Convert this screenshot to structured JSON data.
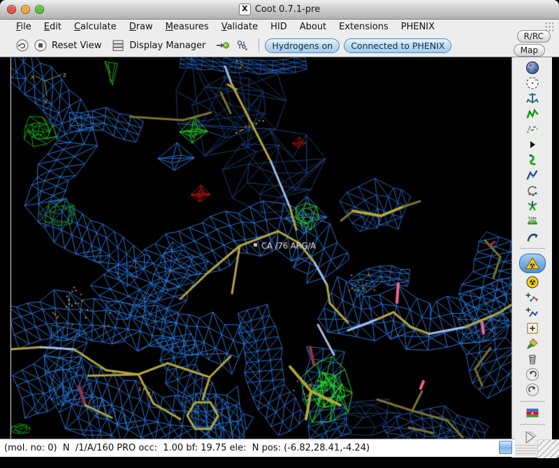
{
  "window": {
    "title": "Coot 0.7.1-pre",
    "logo_glyph": "X",
    "traffic_colors": {
      "close": "#e8554a",
      "minimize": "#f5a63b",
      "zoom": "#58c43d"
    }
  },
  "menu": {
    "items": [
      {
        "label": "File",
        "u": 0
      },
      {
        "label": "Edit",
        "u": 0
      },
      {
        "label": "Calculate",
        "u": 0
      },
      {
        "label": "Draw",
        "u": 0
      },
      {
        "label": "Measures",
        "u": 0
      },
      {
        "label": "Validate",
        "u": 0
      },
      {
        "label": "HID",
        "u": -1
      },
      {
        "label": "About",
        "u": -1
      },
      {
        "label": "Extensions",
        "u": -1
      },
      {
        "label": "PHENIX",
        "u": -1
      }
    ]
  },
  "toolbar": {
    "reset_view": "Reset View",
    "display_manager": "Display Manager",
    "hydrogens_toggle": "Hydrogens on",
    "phenix_toggle": "Connected to PHENIX",
    "toggle_accent": "#bcd9f1"
  },
  "side_buttons": {
    "rrc": "R/RC",
    "map": "Map"
  },
  "right_toolbar": {
    "icons": [
      {
        "name": "sphere-icon"
      },
      {
        "name": "dashed-circle-icon"
      },
      {
        "name": "anchor-icon"
      },
      {
        "name": "green-zigzag-icon"
      },
      {
        "name": "dotted-zigzag-icon"
      },
      {
        "name": "black-triangle-icon"
      },
      {
        "name": "green-rotamer-icon"
      },
      {
        "name": "blue-zigzag-icon"
      },
      {
        "name": "circular-arrow-icon"
      },
      {
        "name": "pinwheel-icon"
      },
      {
        "name": "side-hemisphere-icon"
      },
      {
        "name": "blue-swoosh-icon"
      },
      {
        "name": "separator"
      },
      {
        "name": "radiation-triangle-button",
        "active": true
      },
      {
        "name": "radiation-icon"
      },
      {
        "name": "plus-molecule-icon"
      },
      {
        "name": "plus-blue-molecule-icon"
      },
      {
        "name": "plus-box-icon"
      },
      {
        "name": "paintbrush-icon"
      },
      {
        "name": "trash-icon"
      },
      {
        "name": "undo-icon"
      },
      {
        "name": "redo-icon"
      },
      {
        "name": "separator"
      },
      {
        "name": "flag-icon"
      },
      {
        "name": "separator"
      },
      {
        "name": "expand-triangle-icon"
      }
    ]
  },
  "scene": {
    "atom_label": "CA /76 ARG/A",
    "axes": {
      "x": "x",
      "y": "y",
      "z": "z"
    },
    "colors": {
      "background": "#000000",
      "density_2fofc": "#2b7ce0",
      "density_2fofc_dark": "#1b4078",
      "diff_positive": "#2bd42b",
      "diff_positive_dark": "#1a8e1a",
      "diff_negative": "#b41414",
      "stick_carbon": "#b3a63c",
      "stick_carbon_dark": "#7c732e",
      "stick_oxygen": "#f2628e",
      "stick_nitrogen": "#a6bbe8",
      "stick_red_bond": "#a03040",
      "dots_orange": "#c08020",
      "dots_yellow": "#b2b23a",
      "label_color": "#e8d8d2",
      "axes_color": "#93a37f"
    }
  },
  "statusbar": {
    "text": "(mol. no: 0)  N  /1/A/160 PRO occ:  1.00 bf: 19.75 ele:  N pos: (-6.82,28.41,-4.24)"
  }
}
